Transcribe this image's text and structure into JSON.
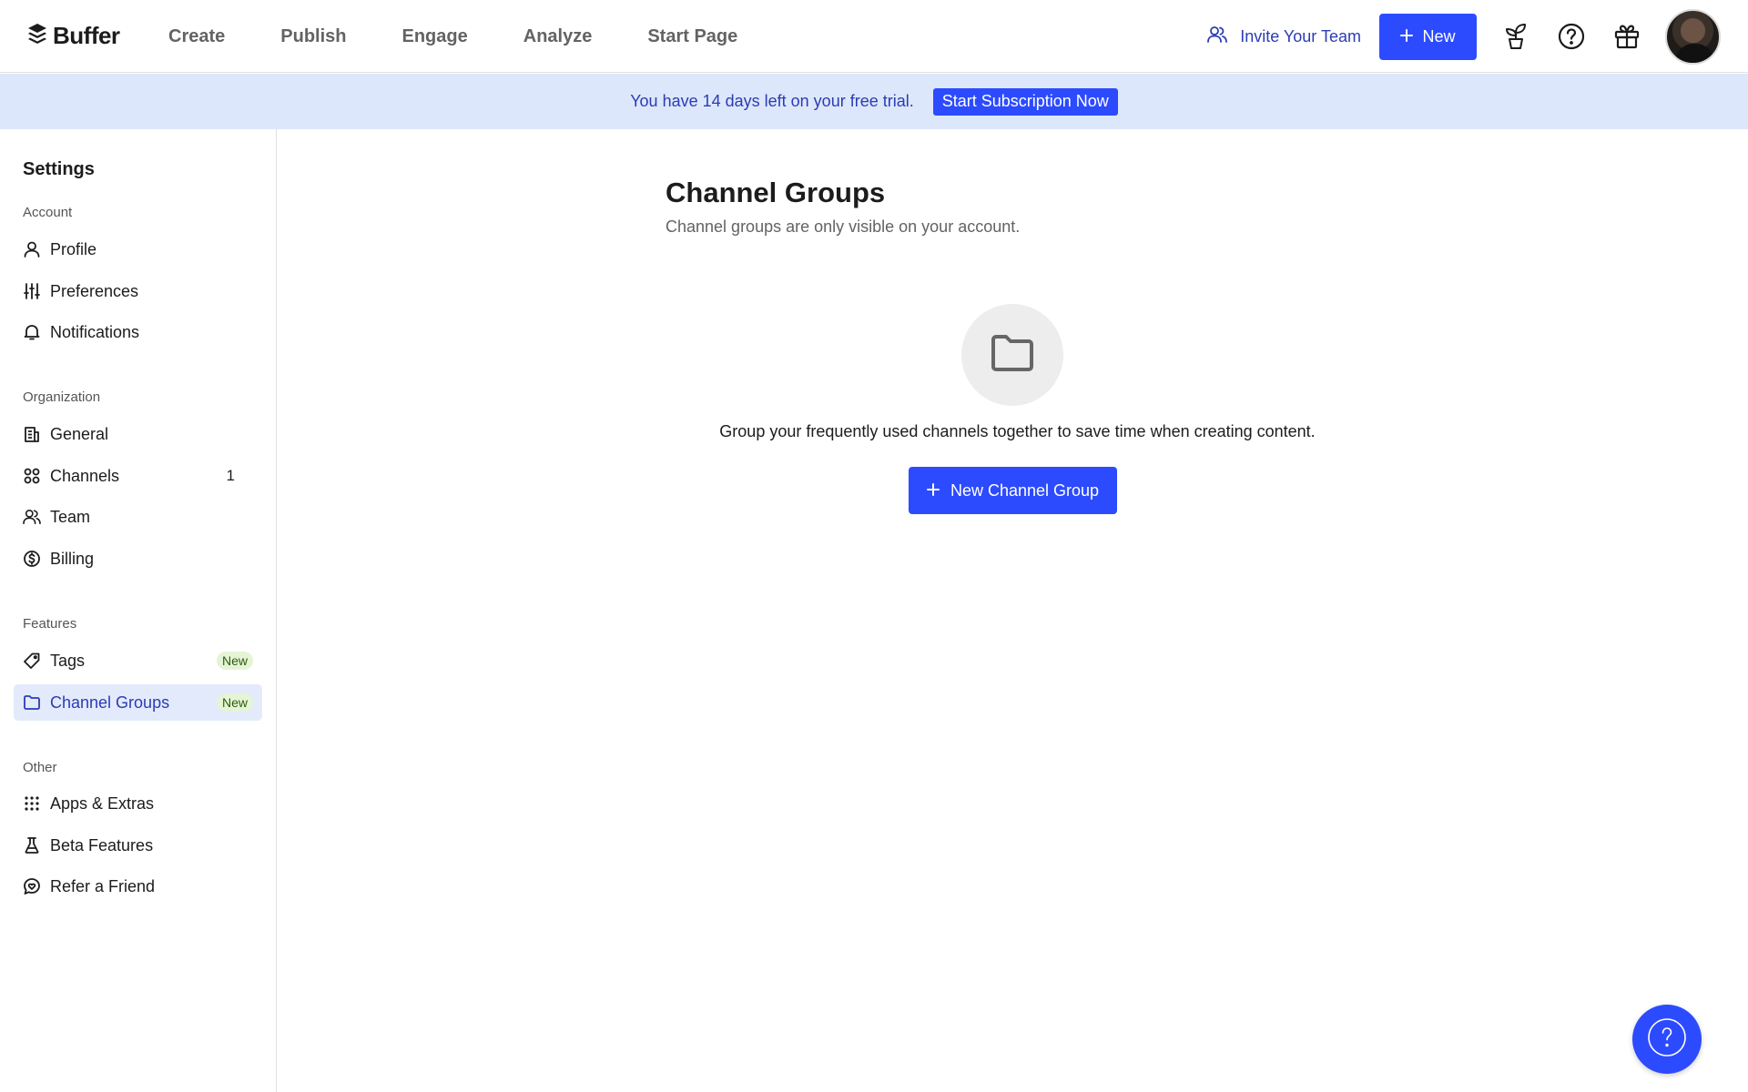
{
  "app": {
    "logo_text": "Buffer"
  },
  "nav": {
    "links": [
      "Create",
      "Publish",
      "Engage",
      "Analyze",
      "Start Page"
    ],
    "invite_label": "Invite Your Team",
    "new_label": "New"
  },
  "banner": {
    "text": "You have 14 days left on your free trial.",
    "cta_label": "Start Subscription Now"
  },
  "sidebar": {
    "title": "Settings",
    "sections": [
      {
        "label": "Account",
        "items": [
          {
            "label": "Profile",
            "icon": "user-icon"
          },
          {
            "label": "Preferences",
            "icon": "sliders-icon"
          },
          {
            "label": "Notifications",
            "icon": "bell-icon"
          }
        ]
      },
      {
        "label": "Organization",
        "items": [
          {
            "label": "General",
            "icon": "building-icon"
          },
          {
            "label": "Channels",
            "icon": "grid-circles-icon",
            "count": "1"
          },
          {
            "label": "Team",
            "icon": "users-icon"
          },
          {
            "label": "Billing",
            "icon": "dollar-circle-icon"
          }
        ]
      },
      {
        "label": "Features",
        "items": [
          {
            "label": "Tags",
            "icon": "tag-icon",
            "badge": "New"
          },
          {
            "label": "Channel Groups",
            "icon": "folder-icon",
            "badge": "New",
            "active": true
          }
        ]
      },
      {
        "label": "Other",
        "items": [
          {
            "label": "Apps & Extras",
            "icon": "apps-grid-icon"
          },
          {
            "label": "Beta Features",
            "icon": "flask-icon"
          },
          {
            "label": "Refer a Friend",
            "icon": "chat-heart-icon"
          }
        ]
      }
    ]
  },
  "main": {
    "title": "Channel Groups",
    "subtitle": "Channel groups are only visible on your account.",
    "empty_text": "Group your frequently used channels together to save time when creating content.",
    "button_label": "New Channel Group"
  },
  "colors": {
    "accent": "#2C4BFF",
    "banner_bg": "#DDE7FB",
    "active_bg": "#E3EAFB",
    "badge_bg": "#E5F4D5"
  }
}
